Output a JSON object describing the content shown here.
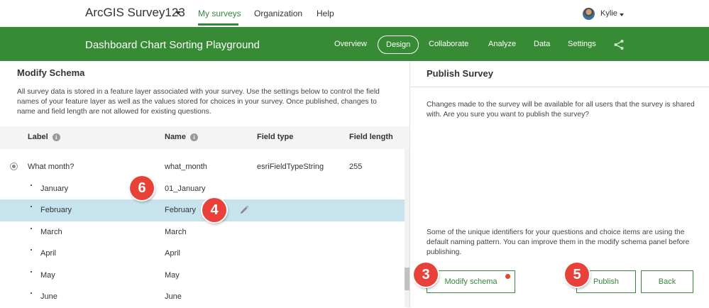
{
  "topbar": {
    "app_title": "ArcGIS Survey123",
    "nav": [
      "My surveys",
      "Organization",
      "Help"
    ],
    "user": "Kylie"
  },
  "greenbar": {
    "survey_title": "Dashboard Chart Sorting Playground",
    "tabs": [
      "Overview",
      "Design",
      "Collaborate",
      "Analyze",
      "Data",
      "Settings"
    ],
    "active_tab": "Design"
  },
  "schema": {
    "title": "Modify Schema",
    "description": "All survey data is stored in a feature layer associated with your survey. Use the settings below to control the field names of your feature layer as well as the values stored for choices in your survey. Once published, changes to name and field length are not allowed for existing questions.",
    "columns": [
      "Label",
      "Name",
      "Field type",
      "Field length"
    ],
    "question": {
      "label": "What month?",
      "name": "what_month",
      "type": "esriFieldTypeString",
      "length": "255"
    },
    "choices": [
      {
        "label": "January",
        "name": "01_January"
      },
      {
        "label": "February",
        "name": "February"
      },
      {
        "label": "March",
        "name": "March"
      },
      {
        "label": "April",
        "name": "April"
      },
      {
        "label": "May",
        "name": "May"
      },
      {
        "label": "June",
        "name": "June"
      }
    ]
  },
  "publish": {
    "title": "Publish Survey",
    "text1": "Changes made to the survey will be available for all users that the survey is shared with. Are you sure you want to publish the survey?",
    "text2": "Some of the unique identifiers for your questions and choice items are using the default naming pattern. You can improve them in the modify schema panel before publishing.",
    "modify_btn": "Modify schema",
    "publish_btn": "Publish",
    "back_btn": "Back"
  },
  "callouts": [
    "3",
    "4",
    "5",
    "6"
  ],
  "colors": {
    "brand_green": "#378b35",
    "callout_red": "#e8413a",
    "selected_row": "#c7e3ee"
  }
}
